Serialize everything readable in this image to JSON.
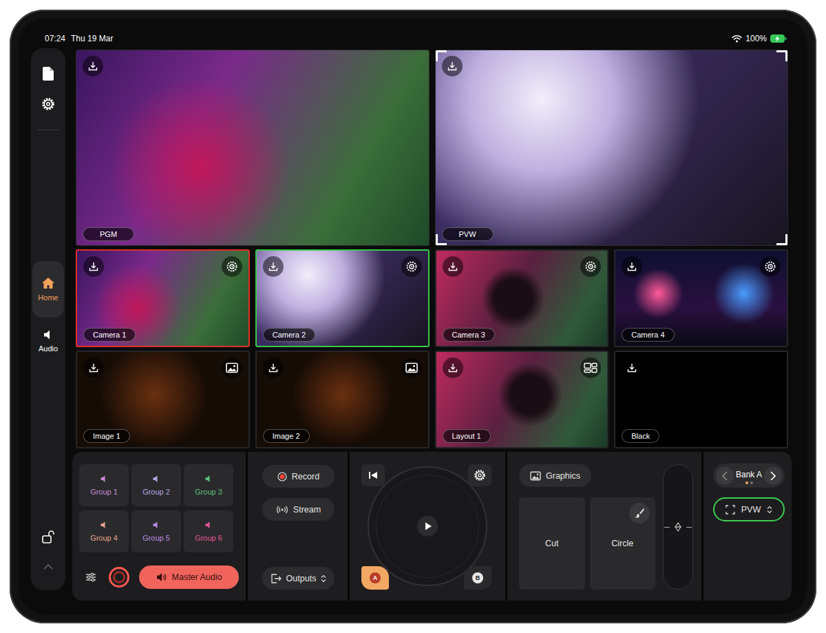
{
  "status_bar": {
    "time": "07:24",
    "date": "Thu 19 Mar",
    "battery": "100%",
    "charging": true
  },
  "sidebar": {
    "items": [
      {
        "label": "Home",
        "selected": true
      },
      {
        "label": "Audio",
        "selected": false
      }
    ],
    "locked": false
  },
  "monitors": [
    {
      "label": "PGM",
      "kind": "program",
      "selected": false
    },
    {
      "label": "PVW",
      "kind": "preview",
      "selected": true
    }
  ],
  "sources": [
    {
      "label": "Camera 1",
      "kind": "camera",
      "program": true,
      "preview": false
    },
    {
      "label": "Camera 2",
      "kind": "camera",
      "program": false,
      "preview": true
    },
    {
      "label": "Camera 3",
      "kind": "camera",
      "program": false,
      "preview": false
    },
    {
      "label": "Camera 4",
      "kind": "camera",
      "program": false,
      "preview": false
    },
    {
      "label": "Image 1",
      "kind": "image",
      "program": false,
      "preview": false
    },
    {
      "label": "Image 2",
      "kind": "image",
      "program": false,
      "preview": false
    },
    {
      "label": "Layout 1",
      "kind": "layout",
      "program": false,
      "preview": false
    },
    {
      "label": "Black",
      "kind": "black",
      "program": false,
      "preview": false
    }
  ],
  "audio": {
    "groups": [
      {
        "label": "Group 1",
        "color": "#c98ad8"
      },
      {
        "label": "Group 2",
        "color": "#b6a4e4"
      },
      {
        "label": "Group 3",
        "color": "#5fbf7a"
      },
      {
        "label": "Group 4",
        "color": "#e6a68c"
      },
      {
        "label": "Group 5",
        "color": "#b98ae0"
      },
      {
        "label": "Group 6",
        "color": "#e0559a"
      }
    ],
    "master": {
      "label": "Master Audio",
      "on": true
    }
  },
  "outputs": {
    "record": "Record",
    "stream": "Stream",
    "outputs": "Outputs"
  },
  "transport": {
    "buses": [
      {
        "label": "A",
        "selected": true
      },
      {
        "label": "B",
        "selected": false
      }
    ]
  },
  "transitions": {
    "graphics": "Graphics",
    "items": [
      {
        "label": "Cut",
        "kind": "cut"
      },
      {
        "label": "Circle",
        "kind": "wipe"
      }
    ],
    "tbar_level": 0.5
  },
  "bank": {
    "label": "Bank A",
    "pages": [
      {
        "selected": true
      },
      {
        "selected": false
      }
    ],
    "output": "PVW"
  }
}
